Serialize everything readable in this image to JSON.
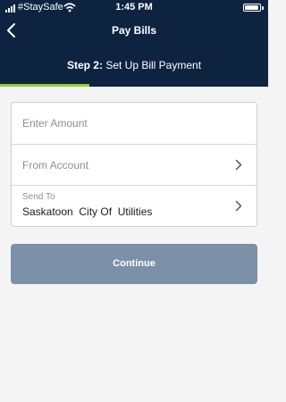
{
  "status_bar": {
    "carrier": "#StaySafe",
    "time": "1:45 PM"
  },
  "header": {
    "title": "Pay Bills",
    "step_prefix": "Step 2:",
    "step_text": " Set Up Bill Payment",
    "progress_fraction": 0.333,
    "back_icon": "chevron-left-icon"
  },
  "form": {
    "amount_placeholder": "Enter Amount",
    "amount_value": "",
    "from_account_placeholder": "From Account",
    "send_to_label": "Send To",
    "send_to_value": "Saskatoon  City Of  Utilities"
  },
  "actions": {
    "continue_label": "Continue"
  },
  "colors": {
    "header_bg": "#0e2340",
    "progress": "#9bcf27",
    "button_disabled": "#7c90a8",
    "page_bg": "#f4f4f4"
  }
}
